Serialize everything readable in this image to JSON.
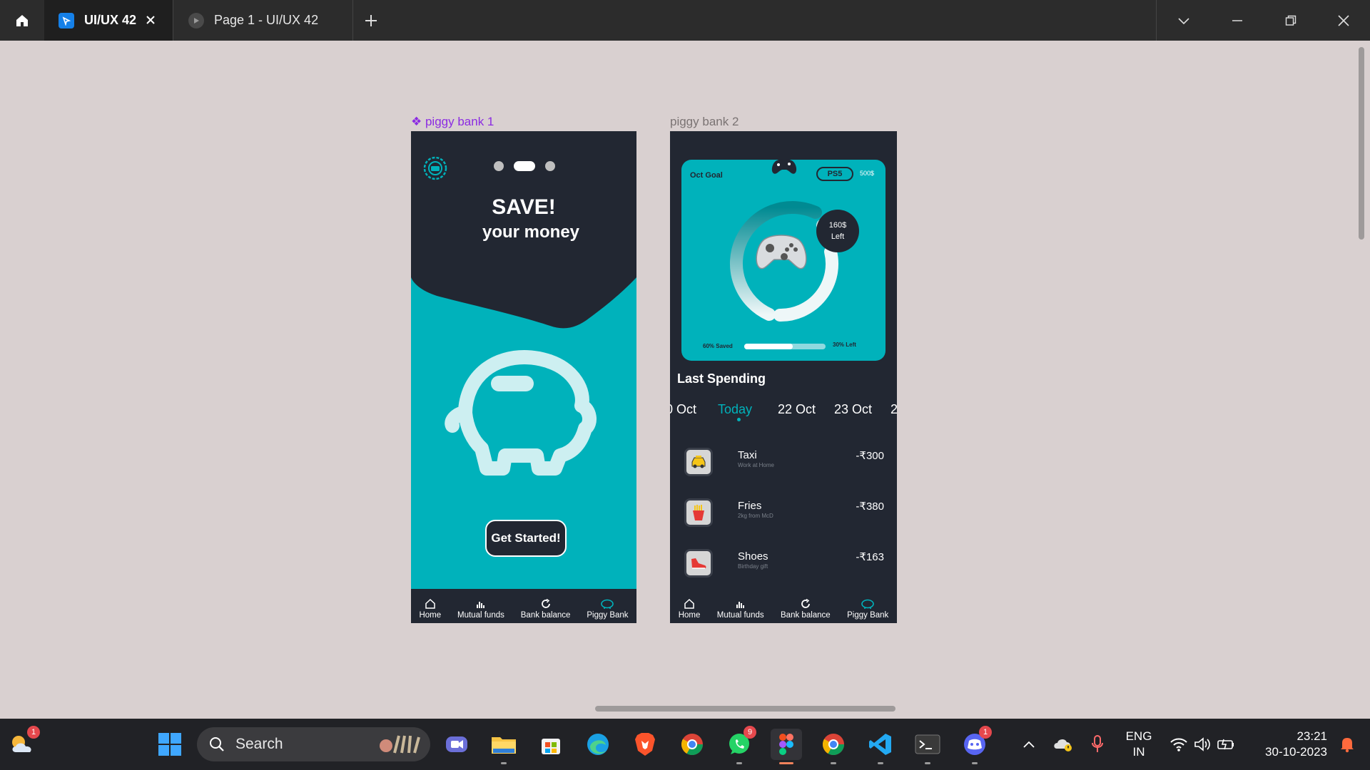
{
  "titlebar": {
    "tabs": [
      {
        "label": "UI/UX 42",
        "active": true
      },
      {
        "label": "Page 1 - UI/UX 42",
        "active": false
      }
    ]
  },
  "canvas": {
    "frame1": {
      "label": "❖ piggy bank 1",
      "title": "SAVE!",
      "subtitle": "your money",
      "cta": "Get Started!"
    },
    "frame2": {
      "label": "piggy bank 2",
      "goal_label": "Oct Goal",
      "goal_item": "PS5",
      "goal_amount": "500$",
      "left_amount": "160$",
      "left_word": "Left",
      "saved_label": "60% Saved",
      "left_label": "30% Left",
      "progress_fraction": 0.6,
      "section_title": "Last Spending",
      "dates": [
        "0 Oct",
        "Today",
        "22 Oct",
        "23 Oct",
        "2"
      ],
      "transactions": [
        {
          "name": "Taxi",
          "sub": "Work at Home",
          "amount": "-₹300",
          "icon": "taxi-icon"
        },
        {
          "name": "Fries",
          "sub": "2kg from McD",
          "amount": "-₹380",
          "icon": "fries-icon"
        },
        {
          "name": "Shoes",
          "sub": "Birthday gift",
          "amount": "-₹163",
          "icon": "shoe-icon"
        }
      ]
    },
    "nav": [
      "Home",
      "Mutual funds",
      "Bank balance",
      "Piggy Bank"
    ]
  },
  "taskbar": {
    "search_placeholder": "Search",
    "weather_badge": "1",
    "whatsapp_badge": "9",
    "discord_badge": "1",
    "lang_line1": "ENG",
    "lang_line2": "IN",
    "time": "23:21",
    "date": "30-10-2023"
  },
  "colors": {
    "teal": "#00b2bb",
    "navy": "#222732",
    "accent_purple": "#8b2be2"
  }
}
